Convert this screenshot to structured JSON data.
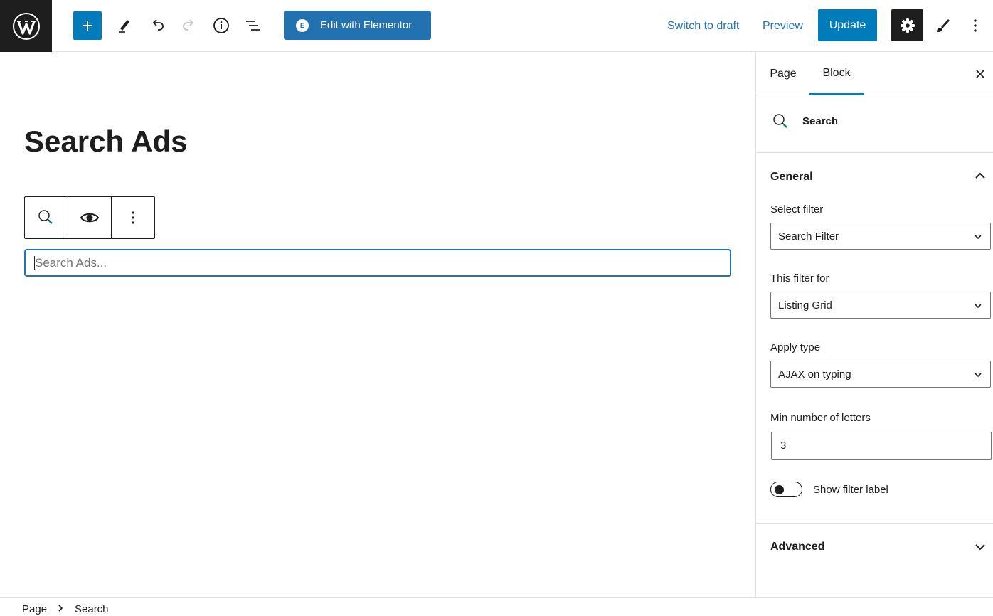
{
  "header": {
    "elementor_label": "Edit with Elementor",
    "elementor_badge": "E",
    "switch_to_draft": "Switch to draft",
    "preview": "Preview",
    "update": "Update"
  },
  "editor": {
    "page_title": "Search Ads",
    "search_placeholder": "Search Ads..."
  },
  "sidebar": {
    "tabs": [
      {
        "label": "Page"
      },
      {
        "label": "Block"
      }
    ],
    "active_tab": "Block",
    "block_name": "Search",
    "general_title": "General",
    "select_filter": {
      "label": "Select filter",
      "value": "Search Filter"
    },
    "filter_for": {
      "label": "This filter for",
      "value": "Listing Grid"
    },
    "apply_type": {
      "label": "Apply type",
      "value": "AJAX on typing"
    },
    "min_letters": {
      "label": "Min number of letters",
      "value": "3"
    },
    "show_label": {
      "label": "Show filter label",
      "enabled": false
    },
    "advanced_title": "Advanced"
  },
  "breadcrumb": [
    {
      "label": "Page"
    },
    {
      "label": "Search"
    }
  ],
  "colors": {
    "accent": "#007cba",
    "elementor": "#2271b1",
    "dark": "#1e1e1e",
    "border": "#e0e0e0"
  }
}
